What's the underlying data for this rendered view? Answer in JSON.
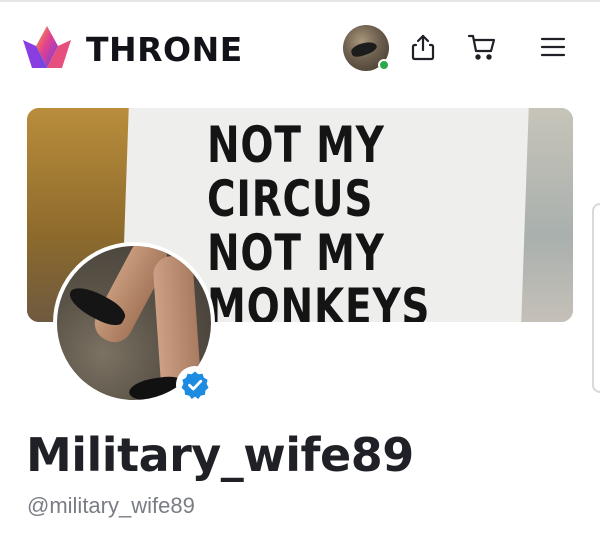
{
  "brand": {
    "name": "THRONE",
    "logo_colors": [
      "#f0a040",
      "#e2408f",
      "#7b3fe4",
      "#4b7cf0"
    ]
  },
  "header": {
    "icons": [
      "share-icon",
      "cart-icon",
      "menu-icon"
    ],
    "avatar_status": "online",
    "status_color": "#2aa84a"
  },
  "banner": {
    "sign_lines": [
      "NOT MY",
      "CIRCUS",
      "NOT MY",
      "MONKEYS"
    ]
  },
  "profile": {
    "display_name": "Military_wife89",
    "handle": "@military_wife89",
    "verified": true,
    "verified_color": "#1d8ce0"
  }
}
